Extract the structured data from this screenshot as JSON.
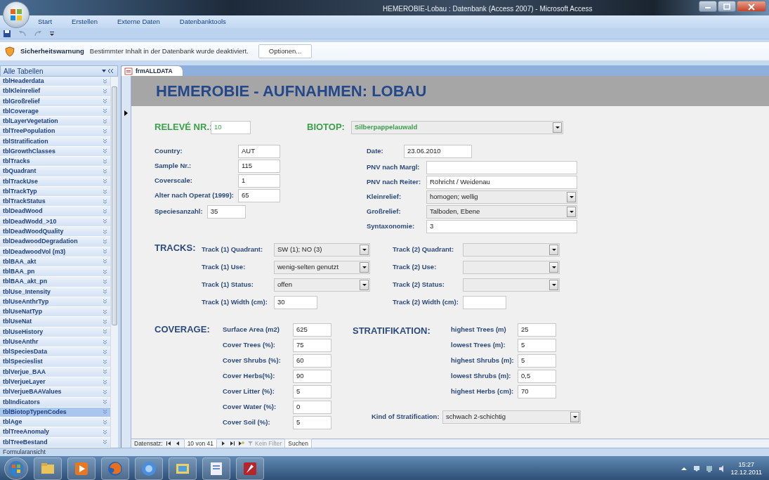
{
  "window": {
    "title": "HEMEROBIE-Lobau : Datenbank (Access 2007) - Microsoft Access"
  },
  "ribbon": {
    "tabs": [
      {
        "label": "Start",
        "selected": false
      },
      {
        "label": "Erstellen",
        "selected": false
      },
      {
        "label": "Externe Daten",
        "selected": false
      },
      {
        "label": "Datenbanktools",
        "selected": false
      }
    ]
  },
  "security_bar": {
    "title": "Sicherheitswarnung",
    "message": "Bestimmter Inhalt in der Datenbank wurde deaktiviert.",
    "button": "Optionen..."
  },
  "navigation_pane": {
    "header": "Alle Tabellen",
    "items": [
      {
        "label": "tblHeaderdata",
        "selected": false
      },
      {
        "label": "tblKleinrelief",
        "selected": false
      },
      {
        "label": "tblGroßrelief",
        "selected": false
      },
      {
        "label": "tblCoverage",
        "selected": false
      },
      {
        "label": "tblLayerVegetation",
        "selected": false
      },
      {
        "label": "tblTreePopulation",
        "selected": false
      },
      {
        "label": "tblStratification",
        "selected": false
      },
      {
        "label": "tblGrowthClasses",
        "selected": false
      },
      {
        "label": "tblTracks",
        "selected": false
      },
      {
        "label": "tbQuadrant",
        "selected": false
      },
      {
        "label": "tblTrackUse",
        "selected": false
      },
      {
        "label": "tblTrackTyp",
        "selected": false
      },
      {
        "label": "tblTrackStatus",
        "selected": false
      },
      {
        "label": "tblDeadWood",
        "selected": false
      },
      {
        "label": "tblDeadWodd_>10",
        "selected": false
      },
      {
        "label": "tblDeadWoodQuality",
        "selected": false
      },
      {
        "label": "tblDeadwoodDegradation",
        "selected": false
      },
      {
        "label": "tblDeadwoodVol (m3)",
        "selected": false
      },
      {
        "label": "tblBAA_akt",
        "selected": false
      },
      {
        "label": "tblBAA_pn",
        "selected": false
      },
      {
        "label": "tblBAA_akt_pn",
        "selected": false
      },
      {
        "label": "tblUse_Intensity",
        "selected": false
      },
      {
        "label": "tblUseAnthrTyp",
        "selected": false
      },
      {
        "label": "tblUseNatTyp",
        "selected": false
      },
      {
        "label": "tblUseNat",
        "selected": false
      },
      {
        "label": "tblUseHistory",
        "selected": false
      },
      {
        "label": "tblUseAnthr",
        "selected": false
      },
      {
        "label": "tblSpeciesData",
        "selected": false
      },
      {
        "label": "tblSpecieslist",
        "selected": false
      },
      {
        "label": "tblVerjue_BAA",
        "selected": false
      },
      {
        "label": "tblVerjueLayer",
        "selected": false
      },
      {
        "label": "tblVerjueBAAValues",
        "selected": false
      },
      {
        "label": "tblIndicators",
        "selected": false
      },
      {
        "label": "tblBiotopTypenCodes",
        "selected": true
      },
      {
        "label": "tblAge",
        "selected": false
      },
      {
        "label": "tblTreeAnomaly",
        "selected": false
      },
      {
        "label": "tblTreeBestand",
        "selected": false
      }
    ]
  },
  "document_tab": {
    "label": "frmALLDATA"
  },
  "form": {
    "title": "HEMEROBIE - AUFNAHMEN: LOBAU",
    "releve": {
      "label": "RELEVÉ NR.:",
      "value": "10",
      "kind": "text"
    },
    "biotop": {
      "label": "BIOTOP:",
      "value": "Silberpappelauwald",
      "kind": "combo"
    },
    "left_fields": [
      {
        "label": "Country:",
        "value": "AUT",
        "kind": "text"
      },
      {
        "label": "Sample Nr.:",
        "value": "115",
        "kind": "text"
      },
      {
        "label": "Coverscale:",
        "value": "1",
        "kind": "text"
      },
      {
        "label": "Alter nach Operat (1999):",
        "value": "65",
        "kind": "text"
      },
      {
        "label": "Speciesanzahl:",
        "value": "35",
        "kind": "text"
      }
    ],
    "right_fields": [
      {
        "label": "Date:",
        "value": "23.06.2010",
        "kind": "text"
      },
      {
        "label": "PNV nach Margl:",
        "kind": "text"
      },
      {
        "label": "PNV nach Reiter:",
        "value": "Röhricht / Weidenau",
        "kind": "text"
      },
      {
        "label": "Kleinrelief:",
        "value": "homogen; wellig",
        "kind": "combo"
      },
      {
        "label": "Großrelief:",
        "value": "Talboden, Ebene",
        "kind": "combo"
      },
      {
        "label": "Syntaxonomie:",
        "value": "3",
        "kind": "text"
      }
    ],
    "tracks": {
      "heading": "TRACKS:",
      "track_1": [
        {
          "label": "Track (1) Quadrant:",
          "value": "SW (1); NO (3)",
          "kind": "combo"
        },
        {
          "label": "Track (1) Use:",
          "value": "wenig-selten genutzt",
          "kind": "combo"
        },
        {
          "label": "Track (1) Status:",
          "value": "offen",
          "kind": "combo"
        },
        {
          "label": "Track (1) Width (cm):",
          "value": "30",
          "kind": "text"
        }
      ],
      "track_2": [
        {
          "label": "Track (2) Quadrant:",
          "kind": "combo"
        },
        {
          "label": "Track (2) Use:",
          "kind": "combo"
        },
        {
          "label": "Track (2) Status:",
          "kind": "combo"
        },
        {
          "label": "Track (2) Width (cm):",
          "kind": "text"
        }
      ]
    },
    "coverage": {
      "heading": "COVERAGE:",
      "fields": [
        {
          "label": "Surface Area (m2)",
          "value": "625",
          "kind": "text"
        },
        {
          "label": "Cover Trees (%):",
          "value": "75",
          "kind": "text"
        },
        {
          "label": "Cover Shrubs (%):",
          "value": "60",
          "kind": "text"
        },
        {
          "label": "Cover Herbs(%):",
          "value": "90",
          "kind": "text"
        },
        {
          "label": "Cover Litter (%):",
          "value": "5",
          "kind": "text"
        },
        {
          "label": "Cover Water (%):",
          "value": "0",
          "kind": "text"
        },
        {
          "label": "Cover Soil (%):",
          "value": "5",
          "kind": "text"
        }
      ]
    },
    "stratification": {
      "heading": "STRATIFIKATION:",
      "fields": [
        {
          "label": "highest Trees (m)",
          "value": "25",
          "kind": "text"
        },
        {
          "label": "lowest Trees (m):",
          "value": "5",
          "kind": "text"
        },
        {
          "label": "highest Shrubs (m):",
          "value": "5",
          "kind": "text"
        },
        {
          "label": "lowest Shrubs (m):",
          "value": "0,5",
          "kind": "text"
        },
        {
          "label": "highest Herbs (cm):",
          "value": "70",
          "kind": "text"
        }
      ],
      "kind_field": {
        "label": "Kind of Stratification:",
        "value": "schwach 2-schichtig",
        "kind": "combo"
      }
    }
  },
  "record_nav": {
    "label": "Datensatz:",
    "position": "10 von 41",
    "filter": "Kein Filter",
    "search": "Suchen"
  },
  "status_bar": {
    "text": "Formularansicht"
  },
  "taskbar": {
    "time": "15:27",
    "date": "12.12.2011"
  }
}
